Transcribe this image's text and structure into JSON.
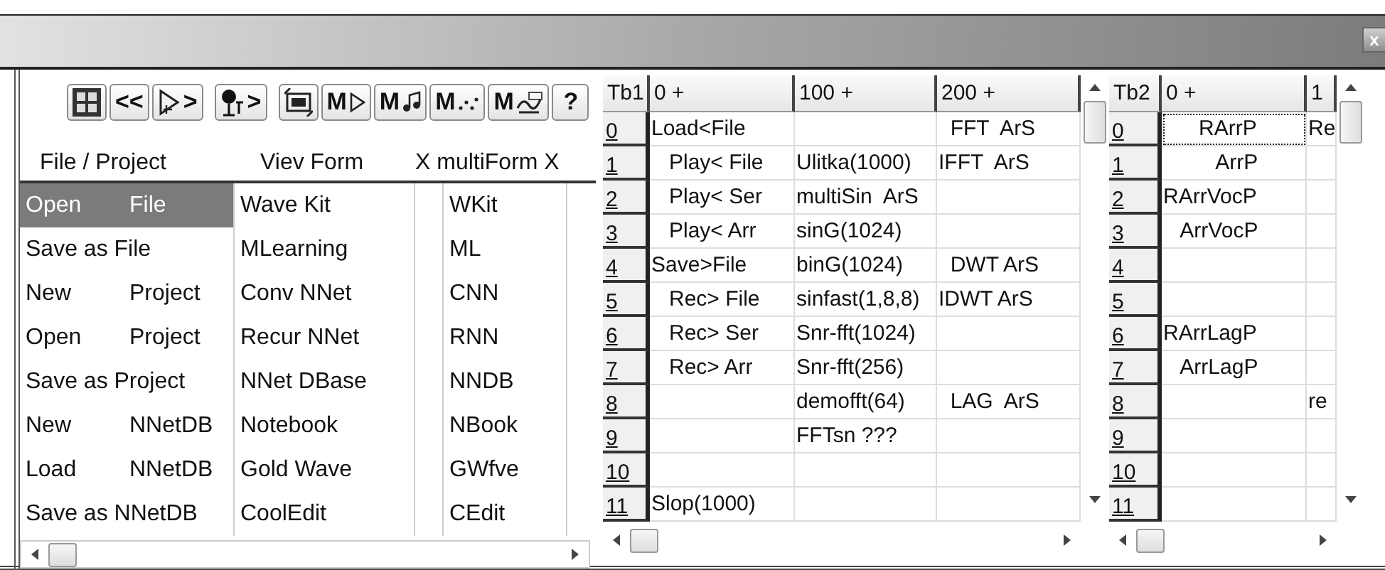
{
  "window": {
    "close_label": "x"
  },
  "toolbar": [
    {
      "kind": "grid"
    },
    {
      "kind": "text",
      "label": "<<"
    },
    {
      "kind": "play",
      "label": ">"
    },
    {
      "kind": "mic",
      "label": ">"
    },
    {
      "kind": "loop"
    },
    {
      "kind": "m-run",
      "label": "M"
    },
    {
      "kind": "m-note",
      "label": "M"
    },
    {
      "kind": "m-dots",
      "label": "M"
    },
    {
      "kind": "m-macro",
      "label": "M"
    },
    {
      "kind": "text",
      "label": "?"
    }
  ],
  "menu": {
    "headers": [
      "File / Project",
      "Viev Form",
      "X multiForm X"
    ],
    "rows": [
      {
        "file": "Open\tFile",
        "form": "Wave Kit",
        "short": "WKit",
        "selected": true
      },
      {
        "file": "Save as File",
        "form": "MLearning",
        "short": "ML",
        "selected": false
      },
      {
        "file": "New\tProject",
        "form": "Conv NNet",
        "short": "CNN",
        "selected": false
      },
      {
        "file": "Open\tProject",
        "form": "Recur NNet",
        "short": "RNN",
        "selected": false
      },
      {
        "file": "Save as Project",
        "form": "NNet DBase",
        "short": "NNDB",
        "selected": false
      },
      {
        "file": "New\tNNetDB",
        "form": "Notebook",
        "short": "NBook",
        "selected": false
      },
      {
        "file": "Load\tNNetDB",
        "form": "Gold Wave",
        "short": "GWfve",
        "selected": false
      },
      {
        "file": "Save as NNetDB",
        "form": "CoolEdit",
        "short": "CEdit",
        "selected": false
      }
    ]
  },
  "tables": [
    {
      "corner": "Tb1",
      "columns": [
        "0 +",
        "100 +",
        "200 +"
      ],
      "rows": [
        {
          "header": "0",
          "cells": [
            {
              "text": "Load<File",
              "selected": false
            },
            {
              "selected": false
            },
            {
              "text": "  FFT  ArS",
              "selected": false
            }
          ]
        },
        {
          "header": "1",
          "cells": [
            {
              "text": "   Play< File",
              "selected": false
            },
            {
              "text": "Ulitka(1000)",
              "selected": false
            },
            {
              "text": "IFFT  ArS",
              "selected": false
            }
          ]
        },
        {
          "header": "2",
          "cells": [
            {
              "text": "   Play< Ser",
              "selected": false
            },
            {
              "text": "multiSin  ArS",
              "selected": false
            },
            {
              "selected": false
            }
          ]
        },
        {
          "header": "3",
          "cells": [
            {
              "text": "   Play< Arr",
              "selected": false
            },
            {
              "text": "sinG(1024)",
              "selected": false
            },
            {
              "selected": false
            }
          ]
        },
        {
          "header": "4",
          "cells": [
            {
              "text": "Save>File",
              "selected": false
            },
            {
              "text": "binG(1024)",
              "selected": false
            },
            {
              "text": "  DWT ArS",
              "selected": false
            }
          ]
        },
        {
          "header": "5",
          "cells": [
            {
              "text": "   Rec> File",
              "selected": false
            },
            {
              "text": "sinfast(1,8,8)",
              "selected": false
            },
            {
              "text": "IDWT ArS",
              "selected": false
            }
          ]
        },
        {
          "header": "6",
          "cells": [
            {
              "text": "   Rec> Ser",
              "selected": false
            },
            {
              "text": "Snr-fft(1024)",
              "selected": false
            },
            {
              "selected": false
            }
          ]
        },
        {
          "header": "7",
          "cells": [
            {
              "text": "   Rec> Arr",
              "selected": false
            },
            {
              "text": "Snr-fft(256)",
              "selected": false
            },
            {
              "selected": false
            }
          ]
        },
        {
          "header": "8",
          "cells": [
            {
              "selected": false
            },
            {
              "text": "demofft(64)",
              "selected": false
            },
            {
              "text": "  LAG  ArS",
              "selected": false
            }
          ]
        },
        {
          "header": "9",
          "cells": [
            {
              "selected": false
            },
            {
              "text": "FFTsn ???",
              "selected": false
            },
            {
              "selected": false
            }
          ]
        },
        {
          "header": "10",
          "cells": [
            {
              "selected": false
            },
            {
              "selected": false
            },
            {
              "selected": false
            }
          ]
        },
        {
          "header": "11",
          "cells": [
            {
              "text": "Slop(1000)",
              "selected": false
            },
            {
              "selected": false
            },
            {
              "selected": false
            }
          ]
        }
      ]
    },
    {
      "corner": "Tb2",
      "columns": [
        "0 +",
        "1"
      ],
      "rows": [
        {
          "header": "0",
          "cells": [
            {
              "text": "      RArrP",
              "selected": true
            },
            {
              "text": "Re",
              "selected": false
            }
          ]
        },
        {
          "header": "1",
          "cells": [
            {
              "text": "         ArrP",
              "selected": false
            },
            {
              "selected": false
            }
          ]
        },
        {
          "header": "2",
          "cells": [
            {
              "text": "RArrVocP",
              "selected": false
            },
            {
              "selected": false
            }
          ]
        },
        {
          "header": "3",
          "cells": [
            {
              "text": "   ArrVocP",
              "selected": false
            },
            {
              "selected": false
            }
          ]
        },
        {
          "header": "4",
          "cells": [
            {
              "selected": false
            },
            {
              "selected": false
            }
          ]
        },
        {
          "header": "5",
          "cells": [
            {
              "selected": false
            },
            {
              "selected": false
            }
          ]
        },
        {
          "header": "6",
          "cells": [
            {
              "text": "RArrLagP",
              "selected": false
            },
            {
              "selected": false
            }
          ]
        },
        {
          "header": "7",
          "cells": [
            {
              "text": "   ArrLagP",
              "selected": false
            },
            {
              "selected": false
            }
          ]
        },
        {
          "header": "8",
          "cells": [
            {
              "selected": false
            },
            {
              "text": "re",
              "selected": false
            }
          ]
        },
        {
          "header": "9",
          "cells": [
            {
              "selected": false
            },
            {
              "selected": false
            }
          ]
        },
        {
          "header": "10",
          "cells": [
            {
              "selected": false
            },
            {
              "selected": false
            }
          ]
        },
        {
          "header": "11",
          "cells": [
            {
              "selected": false
            },
            {
              "selected": false
            }
          ]
        }
      ]
    }
  ]
}
